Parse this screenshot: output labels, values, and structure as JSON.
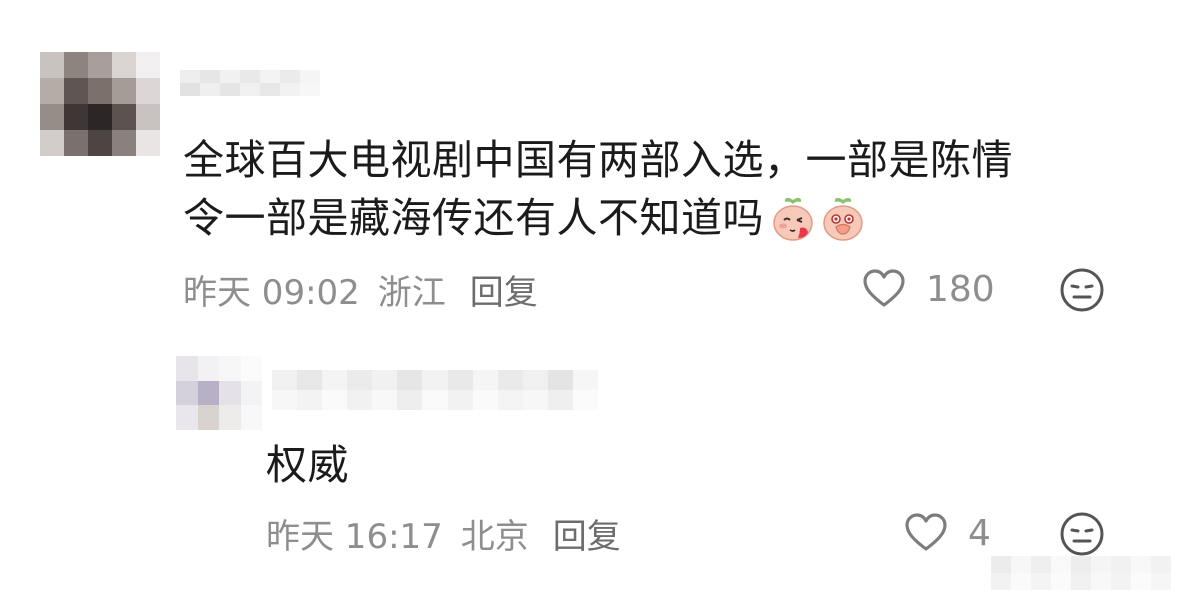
{
  "comment1": {
    "text_line1": "全球百大电视剧中国有两部入选，一部是陈情",
    "text_line2": "令一部是藏海传还有人不知道吗",
    "emojis": [
      "blush-peach-emoji",
      "shy-peach-emoji"
    ],
    "time": "昨天 09:02",
    "location": "浙江",
    "reply_label": "回复",
    "likes": "180"
  },
  "comment2": {
    "text": "权威",
    "time": "昨天 16:17",
    "location": "北京",
    "reply_label": "回复",
    "likes": "4"
  },
  "icons": {
    "like": "heart-outline-icon",
    "dislike": "neutral-face-icon"
  },
  "colors": {
    "text": "#1b1b1b",
    "meta": "#8e8e8e",
    "background": "#ffffff"
  }
}
